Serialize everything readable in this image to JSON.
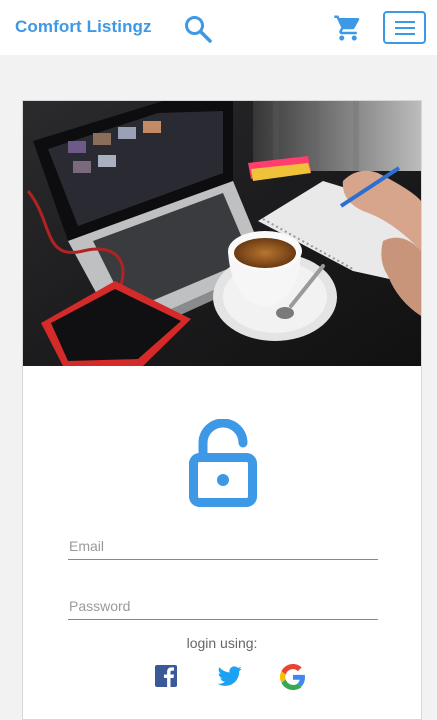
{
  "header": {
    "brand": "Comfort Listingz",
    "icons": {
      "search": "search-icon",
      "cart": "cart-icon",
      "menu": "hamburger-menu-icon"
    }
  },
  "login": {
    "email_placeholder": "Email",
    "password_placeholder": "Password",
    "login_using_label": "login using:",
    "social_icons": [
      "facebook-icon",
      "twitter-icon",
      "google-icon"
    ]
  },
  "colors": {
    "accent": "#3d98e6",
    "background": "#f2f2f2",
    "facebook": "#3b5998",
    "twitter": "#1da1f2"
  }
}
